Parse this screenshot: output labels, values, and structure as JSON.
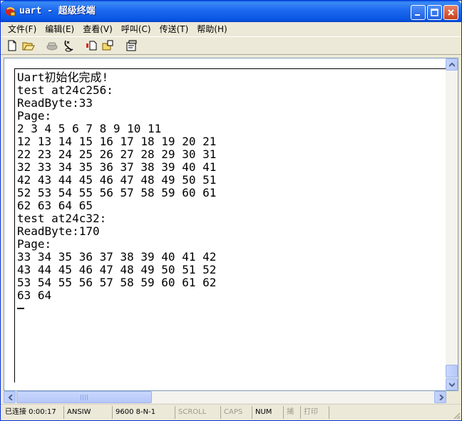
{
  "window": {
    "title": "uart - 超级终端"
  },
  "menu": [
    {
      "label": "文件(F)"
    },
    {
      "label": "编辑(E)"
    },
    {
      "label": "查看(V)"
    },
    {
      "label": "呼叫(C)"
    },
    {
      "label": "传送(T)"
    },
    {
      "label": "帮助(H)"
    }
  ],
  "toolbar": {
    "icons": [
      "new-document-icon",
      "open-folder-icon",
      "dial-phone-icon",
      "disconnect-icon",
      "send-icon",
      "receive-icon",
      "properties-icon"
    ]
  },
  "terminal": {
    "text": "Uart初始化完成!\ntest at24c256:\nReadByte:33\nPage:\n2 3 4 5 6 7 8 9 10 11\n12 13 14 15 16 17 18 19 20 21\n22 23 24 25 26 27 28 29 30 31\n32 33 34 35 36 37 38 39 40 41\n42 43 44 45 46 47 48 49 50 51\n52 53 54 55 56 57 58 59 60 61\n62 63 64 65\ntest at24c32:\nReadByte:170\nPage:\n33 34 35 36 37 38 39 40 41 42\n43 44 45 46 47 48 49 50 51 52\n53 54 55 56 57 58 59 60 61 62\n63 64"
  },
  "statusbar": {
    "connection": "已连接 0:00:17",
    "emulation": "ANSIW",
    "settings": "9600 8-N-1",
    "scroll": "SCROLL",
    "caps": "CAPS",
    "num": "NUM",
    "capture": "捕",
    "print": "打印"
  }
}
